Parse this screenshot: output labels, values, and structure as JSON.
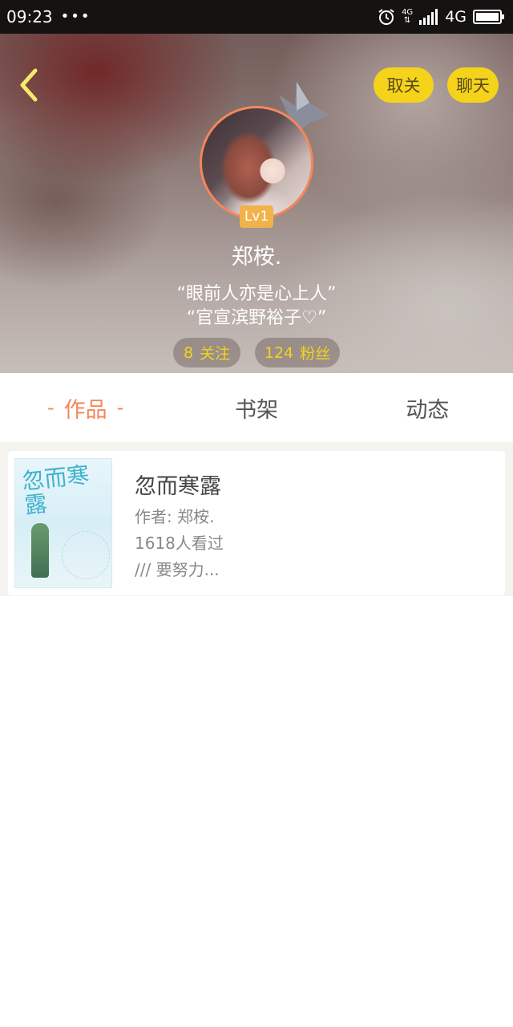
{
  "status_bar": {
    "time": "09:23",
    "dots": "•••",
    "network_small": "4G",
    "network": "4G"
  },
  "nav": {
    "unfollow_label": "取关",
    "chat_label": "聊天"
  },
  "profile": {
    "level": "Lv1",
    "name": "郑桉.",
    "bio_line_1": "“眼前人亦是心上人”",
    "bio_line_2": "“官宣滨野裕子♡”",
    "following_count": "8",
    "following_label": "关注",
    "fans_count": "124",
    "fans_label": "粉丝"
  },
  "tabs": [
    {
      "label": "作品",
      "active": true
    },
    {
      "label": "书架",
      "active": false
    },
    {
      "label": "动态",
      "active": false
    }
  ],
  "books": [
    {
      "title": "忽而寒露",
      "author": "作者: 郑桉.",
      "views": "1618人看过",
      "intro": "/// 要努力...",
      "cover_title": "忽而寒露"
    }
  ],
  "colors": {
    "accent": "#f4875a",
    "button_yellow": "#f5d31b",
    "level_badge": "#f1b24a"
  }
}
